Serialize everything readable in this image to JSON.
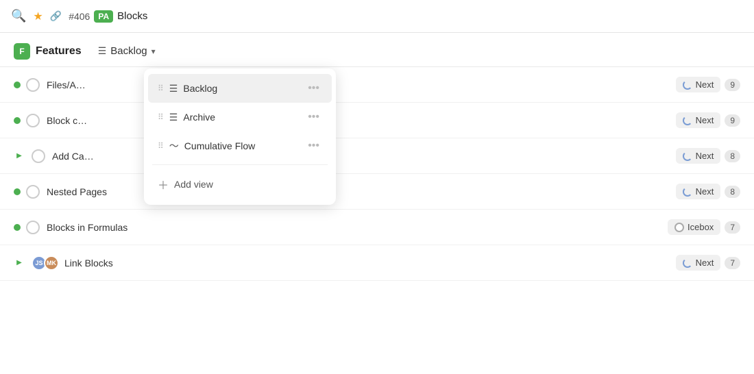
{
  "topbar": {
    "issue_number": "#406",
    "badge": "PA",
    "title": "Blocks"
  },
  "header": {
    "features_label": "Features",
    "features_icon": "F",
    "backlog_label": "Backlog"
  },
  "dropdown": {
    "items": [
      {
        "id": "backlog",
        "label": "Backlog",
        "active": true
      },
      {
        "id": "archive",
        "label": "Archive",
        "active": false
      },
      {
        "id": "cumulative-flow",
        "label": "Cumulative Flow",
        "active": false
      }
    ],
    "add_view_label": "Add view"
  },
  "rows": [
    {
      "id": "row1",
      "title": "Files/A…",
      "status": "next",
      "status_label": "Next",
      "count": "9",
      "has_expand": false,
      "has_avatars": false
    },
    {
      "id": "row2",
      "title": "Block c…",
      "status": "next",
      "status_label": "Next",
      "count": "9",
      "has_expand": false,
      "has_avatars": false
    },
    {
      "id": "row3",
      "title": "Add Ca…",
      "status": "next",
      "status_label": "Next",
      "count": "8",
      "has_expand": true,
      "has_avatars": false
    },
    {
      "id": "row4",
      "title": "Nested Pages",
      "status": "next",
      "status_label": "Next",
      "count": "8",
      "has_expand": false,
      "has_avatars": false
    },
    {
      "id": "row5",
      "title": "Blocks in Formulas",
      "status": "icebox",
      "status_label": "Icebox",
      "count": "7",
      "has_expand": false,
      "has_avatars": false
    },
    {
      "id": "row6",
      "title": "Link Blocks",
      "status": "next",
      "status_label": "Next",
      "count": "7",
      "has_expand": true,
      "has_avatars": true
    }
  ]
}
